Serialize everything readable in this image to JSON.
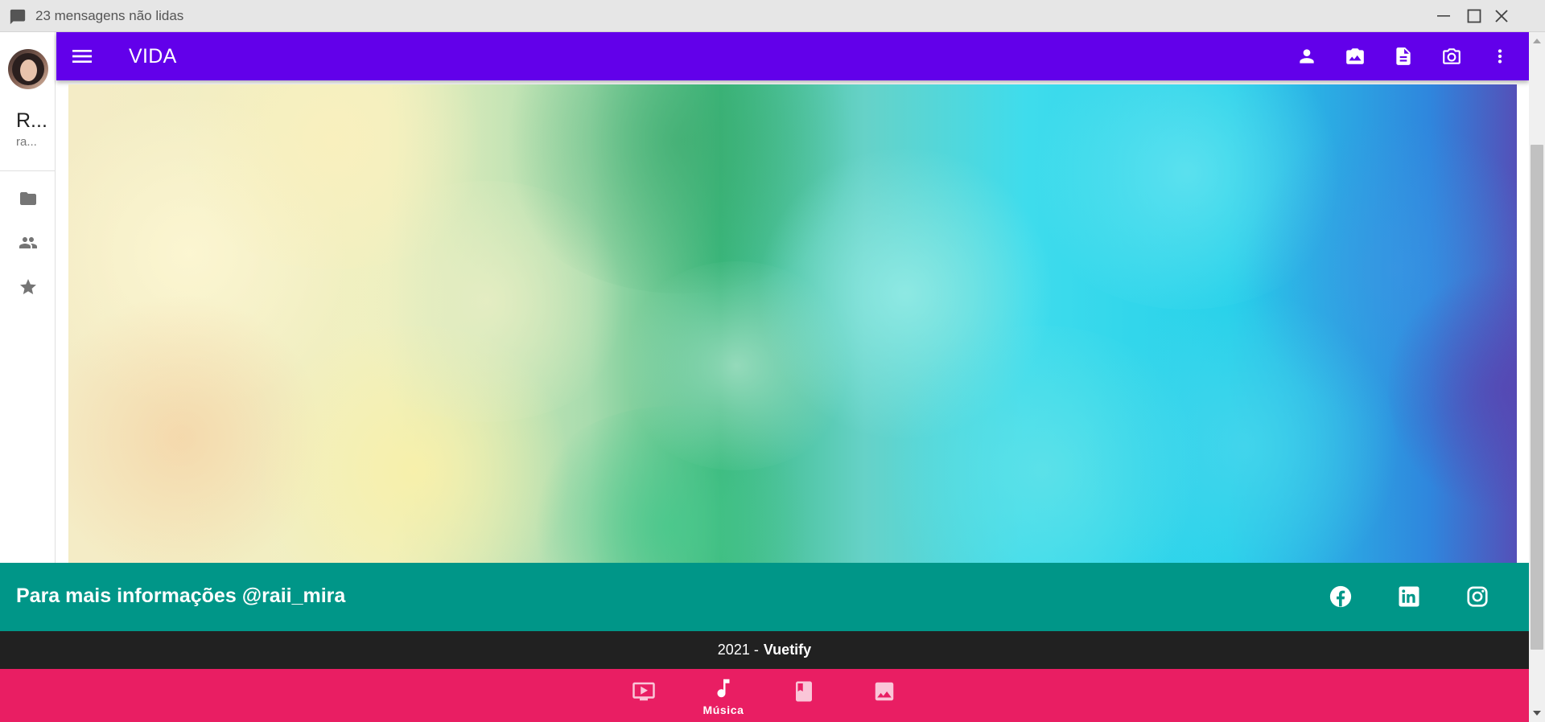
{
  "window": {
    "title": "23 mensagens não lidas",
    "icon": "chat-icon",
    "controls": [
      "minimize-icon",
      "maximize-icon",
      "close-icon"
    ]
  },
  "rail": {
    "user_name": "R...",
    "user_email": "ra...",
    "items": [
      {
        "icon": "folder-icon"
      },
      {
        "icon": "people-icon"
      },
      {
        "icon": "star-icon"
      }
    ]
  },
  "appbar": {
    "title": "VIDA",
    "menu_icon": "menu-icon",
    "actions": [
      "account-icon",
      "camera-switch-icon",
      "document-icon",
      "camera-icon",
      "more-vert-icon"
    ],
    "color": "#6200ea"
  },
  "footer": {
    "text": "Para mais informações @raii_mira",
    "social": [
      "facebook-icon",
      "linkedin-icon",
      "instagram-icon"
    ],
    "color": "#009688"
  },
  "copyright": {
    "year_prefix": "2021 -",
    "brand": "Vuetify"
  },
  "bottom_nav": {
    "color": "#e91e63",
    "items": [
      {
        "icon": "tv-play-icon",
        "label": "",
        "active": false
      },
      {
        "icon": "music-note-icon",
        "label": "Música",
        "active": true
      },
      {
        "icon": "book-icon",
        "label": "",
        "active": false
      },
      {
        "icon": "image-icon",
        "label": "",
        "active": false
      }
    ]
  }
}
